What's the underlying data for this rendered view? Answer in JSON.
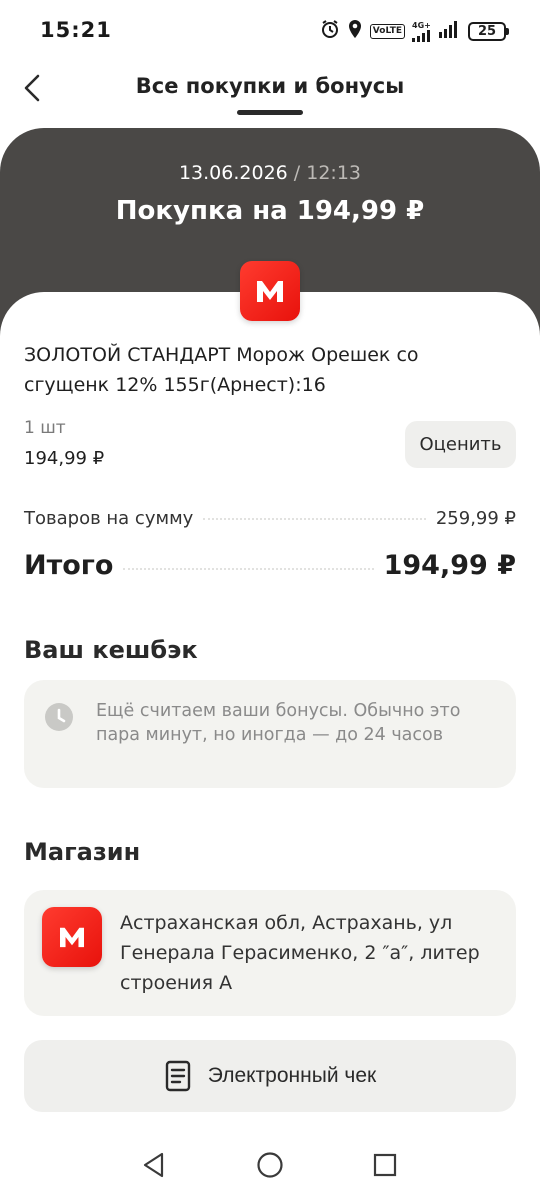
{
  "status_bar": {
    "time": "15:21",
    "volte_label": "VoLTE",
    "network_label": "4G+",
    "battery_level": "25"
  },
  "header": {
    "title": "Все покупки и бонусы"
  },
  "purchase": {
    "date": "13.06.2026",
    "separator": " / ",
    "time": "12:13",
    "total_title": "Покупка на 194,99 ₽",
    "logo_letter": "М"
  },
  "product": {
    "name": "ЗОЛОТОЙ СТАНДАРТ Морож Орешек со сгущенк 12% 155г(Арнест):16",
    "quantity": "1 шт",
    "price": "194,99 ₽",
    "rate_label": "Оценить"
  },
  "summary": {
    "goods_label": "Товаров на сумму",
    "goods_value": "259,99 ₽",
    "total_label": "Итого",
    "total_value": "194,99 ₽"
  },
  "cashback": {
    "title": "Ваш кешбэк",
    "message": "Ещё считаем ваши бонусы. Обычно это пара минут, но иногда — до 24 часов"
  },
  "shop": {
    "title": "Магазин",
    "logo_letter": "М",
    "address": "Астраханская обл, Астрахань, ул Генерала Герасименко, 2 ″а″, литер строения А"
  },
  "receipt": {
    "label": "Электронный чек"
  },
  "colors": {
    "brand_red": "#ff2d20",
    "dark_panel": "#4a4846",
    "card_bg": "#f3f3f0"
  }
}
